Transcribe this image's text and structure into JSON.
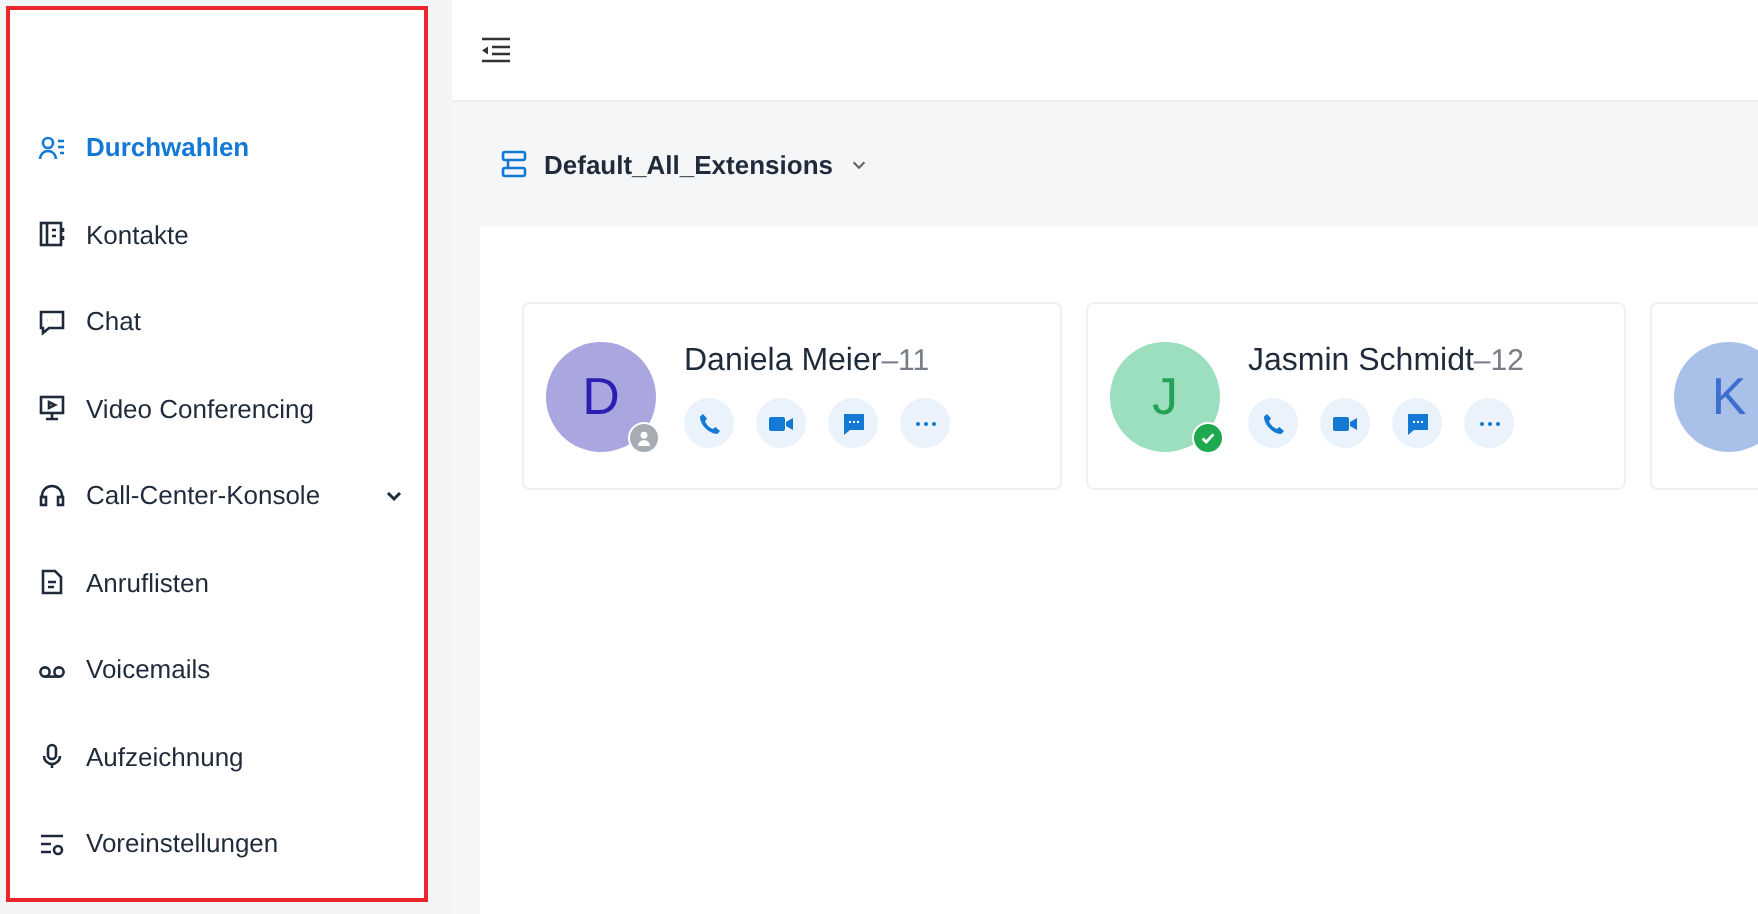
{
  "sidebar": {
    "items": [
      {
        "label": "Durchwahlen",
        "kind": "users",
        "selected": true
      },
      {
        "label": "Kontakte",
        "kind": "book",
        "selected": false
      },
      {
        "label": "Chat",
        "kind": "chat",
        "selected": false
      },
      {
        "label": "Video Conferencing",
        "kind": "monitor",
        "selected": false
      },
      {
        "label": "Call-Center-Konsole",
        "kind": "headset",
        "selected": false,
        "expandable": true
      },
      {
        "label": "Anruflisten",
        "kind": "doc",
        "selected": false
      },
      {
        "label": "Voicemails",
        "kind": "voicemail",
        "selected": false
      },
      {
        "label": "Aufzeichnung",
        "kind": "mic",
        "selected": false
      },
      {
        "label": "Voreinstellungen",
        "kind": "settings",
        "selected": false
      }
    ]
  },
  "group_selector": {
    "label": "Default_All_Extensions"
  },
  "extensions": [
    {
      "initial": "D",
      "name": "Daniela Meier",
      "number": "–11",
      "color": "#aaa6e0",
      "kind": "offline"
    },
    {
      "initial": "J",
      "name": "Jasmin Schmidt",
      "number": "–12",
      "color": "#9cdfbf",
      "kind": "available"
    },
    {
      "initial": "K",
      "color": "#a9c1e8"
    }
  ]
}
